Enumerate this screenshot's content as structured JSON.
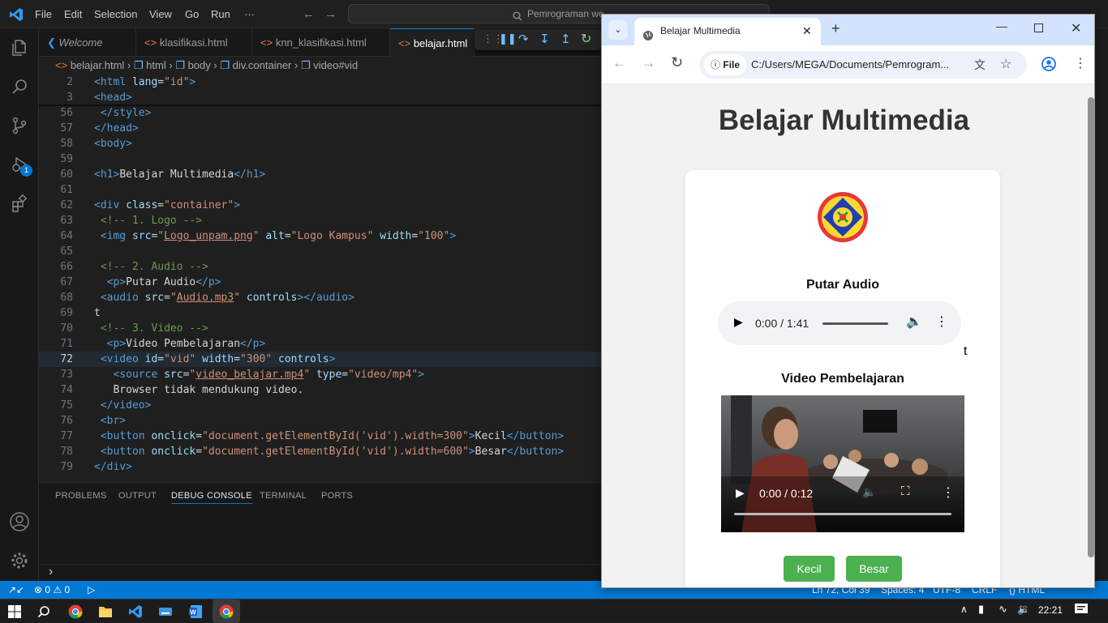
{
  "vscode": {
    "menu": [
      "File",
      "Edit",
      "Selection",
      "View",
      "Go",
      "Run",
      "···"
    ],
    "search_text": "Pemrograman we",
    "tabs": [
      {
        "label": "Welcome"
      },
      {
        "label": "klasifikasi.html"
      },
      {
        "label": "knn_klasifikasi.html"
      },
      {
        "label": "belajar.html"
      }
    ],
    "breadcrumb": [
      "belajar.html",
      "html",
      "body",
      "div.container",
      "video#vid"
    ],
    "debug_badge": "1",
    "lines": [
      {
        "n": "2",
        "html": "<span class='tg'>&lt;html</span> <span class='at'>lang</span><span class='tx'>=</span><span class='st'>\"id\"</span><span class='tg'>&gt;</span>"
      },
      {
        "n": "3",
        "html": "<span class='tg'>&lt;head&gt;</span>"
      },
      {
        "n": "56",
        "html": " <span class='tg'>&lt;/style&gt;</span>"
      },
      {
        "n": "57",
        "html": "<span class='tg'>&lt;/head&gt;</span>"
      },
      {
        "n": "58",
        "html": "<span class='tg'>&lt;body&gt;</span>"
      },
      {
        "n": "59",
        "html": ""
      },
      {
        "n": "60",
        "html": "<span class='tg'>&lt;h1&gt;</span><span class='tx'>Belajar Multimedia</span><span class='tg'>&lt;/h1&gt;</span>"
      },
      {
        "n": "61",
        "html": ""
      },
      {
        "n": "62",
        "html": "<span class='tg'>&lt;div</span> <span class='at'>class</span><span class='tx'>=</span><span class='st'>\"container\"</span><span class='tg'>&gt;</span>"
      },
      {
        "n": "63",
        "html": " <span class='cm'>&lt;!-- 1. Logo --&gt;</span>"
      },
      {
        "n": "64",
        "html": " <span class='tg'>&lt;img</span> <span class='at'>src</span><span class='tx'>=</span><span class='st'>\"<span class='ul'>Logo_unpam.png</span>\"</span> <span class='at'>alt</span><span class='tx'>=</span><span class='st'>\"Logo Kampus\"</span> <span class='at'>width</span><span class='tx'>=</span><span class='st'>\"100\"</span><span class='tg'>&gt;</span>"
      },
      {
        "n": "65",
        "html": ""
      },
      {
        "n": "66",
        "html": " <span class='cm'>&lt;!-- 2. Audio --&gt;</span>"
      },
      {
        "n": "67",
        "html": "  <span class='tg'>&lt;p&gt;</span><span class='tx'>Putar Audio</span><span class='tg'>&lt;/p&gt;</span>"
      },
      {
        "n": "68",
        "html": " <span class='tg'>&lt;audio</span> <span class='at'>src</span><span class='tx'>=</span><span class='st'>\"<span class='ul'>Audio.mp3</span>\"</span> <span class='at'>controls</span><span class='tg'>&gt;&lt;/audio&gt;</span>"
      },
      {
        "n": "69",
        "html": "<span class='tx'>t</span>"
      },
      {
        "n": "70",
        "html": " <span class='cm'>&lt;!-- 3. Video --&gt;</span>"
      },
      {
        "n": "71",
        "html": "  <span class='tg'>&lt;p&gt;</span><span class='tx'>Video Pembelajaran</span><span class='tg'>&lt;/p&gt;</span>"
      },
      {
        "n": "72",
        "html": " <span class='tg'>&lt;video</span> <span class='at'>id</span><span class='tx'>=</span><span class='st'>\"vid\"</span> <span class='at'>width</span><span class='tx'>=</span><span class='st'>\"300\"</span> <span class='at'>controls</span><span class='tg'>&gt;</span>"
      },
      {
        "n": "73",
        "html": "   <span class='tg'>&lt;source</span> <span class='at'>src</span><span class='tx'>=</span><span class='st'>\"<span class='ul'>video_belajar.mp4</span>\"</span> <span class='at'>type</span><span class='tx'>=</span><span class='st'>\"video/mp4\"</span><span class='tg'>&gt;</span>"
      },
      {
        "n": "74",
        "html": "   <span class='tx'>Browser tidak mendukung video.</span>"
      },
      {
        "n": "75",
        "html": " <span class='tg'>&lt;/video&gt;</span>"
      },
      {
        "n": "76",
        "html": " <span class='tg'>&lt;br&gt;</span>"
      },
      {
        "n": "77",
        "html": " <span class='tg'>&lt;button</span> <span class='at'>onclick</span><span class='tx'>=</span><span class='st'>\"document.getElementById('vid').width=300\"</span><span class='tg'>&gt;</span><span class='tx'>Kecil</span><span class='tg'>&lt;/button&gt;</span>"
      },
      {
        "n": "78",
        "html": " <span class='tg'>&lt;button</span> <span class='at'>onclick</span><span class='tx'>=</span><span class='st'>\"document.getElementById('vid').width=600\"</span><span class='tg'>&gt;</span><span class='tx'>Besar</span><span class='tg'>&lt;/button&gt;</span>"
      },
      {
        "n": "79",
        "html": "<span class='tg'>&lt;/div&gt;</span>"
      }
    ],
    "panel_tabs": [
      "PROBLEMS",
      "OUTPUT",
      "DEBUG CONSOLE",
      "TERMINAL",
      "PORTS"
    ],
    "status": {
      "errors": "0",
      "warnings": "0",
      "position": "Ln 72, Col 39",
      "spaces": "Spaces: 4",
      "encoding": "UTF-8",
      "eol": "CRLF",
      "language": "HTML"
    }
  },
  "browser": {
    "tab_title": "Belajar Multimedia",
    "url_prefix": "File",
    "url": "C:/Users/MEGA/Documents/Pemrogram...",
    "page": {
      "heading": "Belajar Multimedia",
      "audio_label": "Putar Audio",
      "audio_time": "0:00 / 1:41",
      "stray_text": "t",
      "video_label": "Video Pembelajaran",
      "video_time": "0:00 / 0:12",
      "button_small": "Kecil",
      "button_large": "Besar"
    }
  },
  "taskbar": {
    "time": "22:21"
  }
}
